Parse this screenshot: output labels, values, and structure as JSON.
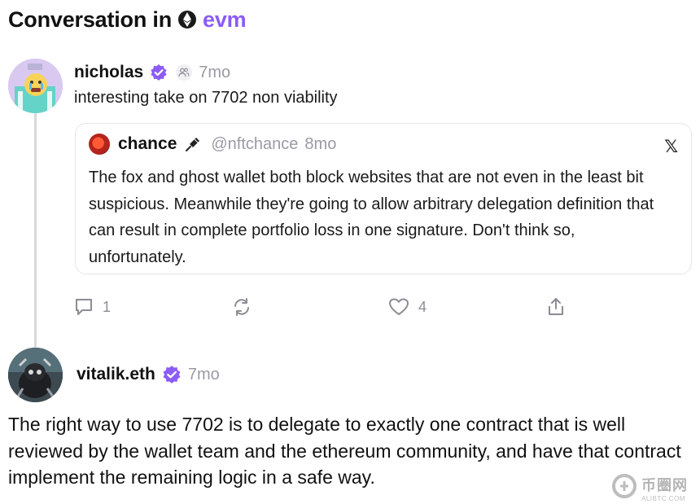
{
  "header": {
    "title": "Conversation in",
    "channel": "evm",
    "channel_icon": "ethereum-icon"
  },
  "post": {
    "author": "nicholas",
    "verified_icon": "verified-badge-icon",
    "channel_icon": "channel-members-icon",
    "time": "7mo",
    "text": "interesting take on 7702 non viability",
    "quote": {
      "author": "chance",
      "emoji_icon": "pen-nib-icon",
      "handle": "@nftchance",
      "time": "8mo",
      "source_icon": "x-logo-icon",
      "source_glyph": "𝕏",
      "text": "The fox and ghost wallet both block websites that are not even in the least bit suspicious. Meanwhile they're going to allow arbitrary delegation definition that can result in complete portfolio loss in one signature. Don't think so, unfortunately."
    },
    "actions": {
      "reply_count": "1",
      "recast_count": "",
      "like_count": "4"
    }
  },
  "reply": {
    "author": "vitalik.eth",
    "time": "7mo",
    "text": "The right way to use 7702 is to delegate to exactly one contract that is well reviewed by the wallet team and the ethereum community, and have that contract implement the remaining logic in a safe way."
  },
  "watermark": {
    "title": "币圈网",
    "subtitle": "ALIBTC.COM"
  },
  "colors": {
    "accent": "#8B5CF6",
    "muted": "#9a9aa4"
  }
}
